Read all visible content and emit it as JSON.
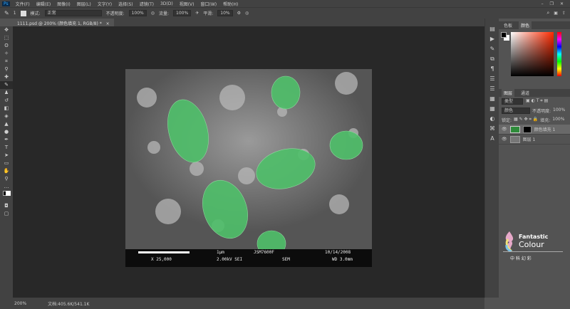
{
  "menu": {
    "logo": "Ps",
    "items": [
      "文件(F)",
      "编辑(E)",
      "图像(I)",
      "图层(L)",
      "文字(Y)",
      "选择(S)",
      "滤镜(T)",
      "3D(D)",
      "视图(V)",
      "窗口(W)",
      "帮助(H)"
    ]
  },
  "window_controls": {
    "minimize": "–",
    "restore": "❐",
    "close": "✕"
  },
  "options": {
    "brush_size": "1",
    "mode_label": "模式:",
    "mode_value": "正常",
    "opacity_label": "不透明度:",
    "opacity_value": "100%",
    "flow_label": "流量:",
    "flow_value": "100%",
    "smooth_label": "平滑:",
    "smooth_value": "10%"
  },
  "document_tab": {
    "title": "1111.psd @ 200% (颜色填充 1, RGB/8) *",
    "close": "×"
  },
  "status": {
    "zoom": "200%",
    "doc_size": "文档:405.6K/541.1K"
  },
  "sem": {
    "scale": "1μm",
    "instrument": "JSM7600F",
    "date": "10/14/2008",
    "magnification": "X 25,000",
    "voltage": "2.00kV SEI",
    "mode": "SEM",
    "wd": "WD 3.0mm"
  },
  "color_panel": {
    "tabs": [
      "色板",
      "颜色"
    ],
    "active": "颜色",
    "fg": "#000000",
    "bg": "#ffffff",
    "hue": "#ff2a00"
  },
  "layers_panel": {
    "tabs": [
      "图层",
      "通道"
    ],
    "kind_filter": "类型",
    "blend_mode": "颜色",
    "opacity_label": "不透明度:",
    "opacity_value": "100%",
    "lock_label": "锁定:",
    "fill_label": "填充:",
    "fill_value": "100%",
    "layers": [
      {
        "name": "颜色填充 1",
        "color": "#2e8b3a",
        "selected": true
      },
      {
        "name": "图层 1",
        "selected": false
      }
    ]
  },
  "watermark": {
    "line1": "Fantastic",
    "line2": "Colour",
    "line3": "中 科 幻 彩"
  },
  "colors": {
    "highlight_green": "#4fc06a"
  }
}
